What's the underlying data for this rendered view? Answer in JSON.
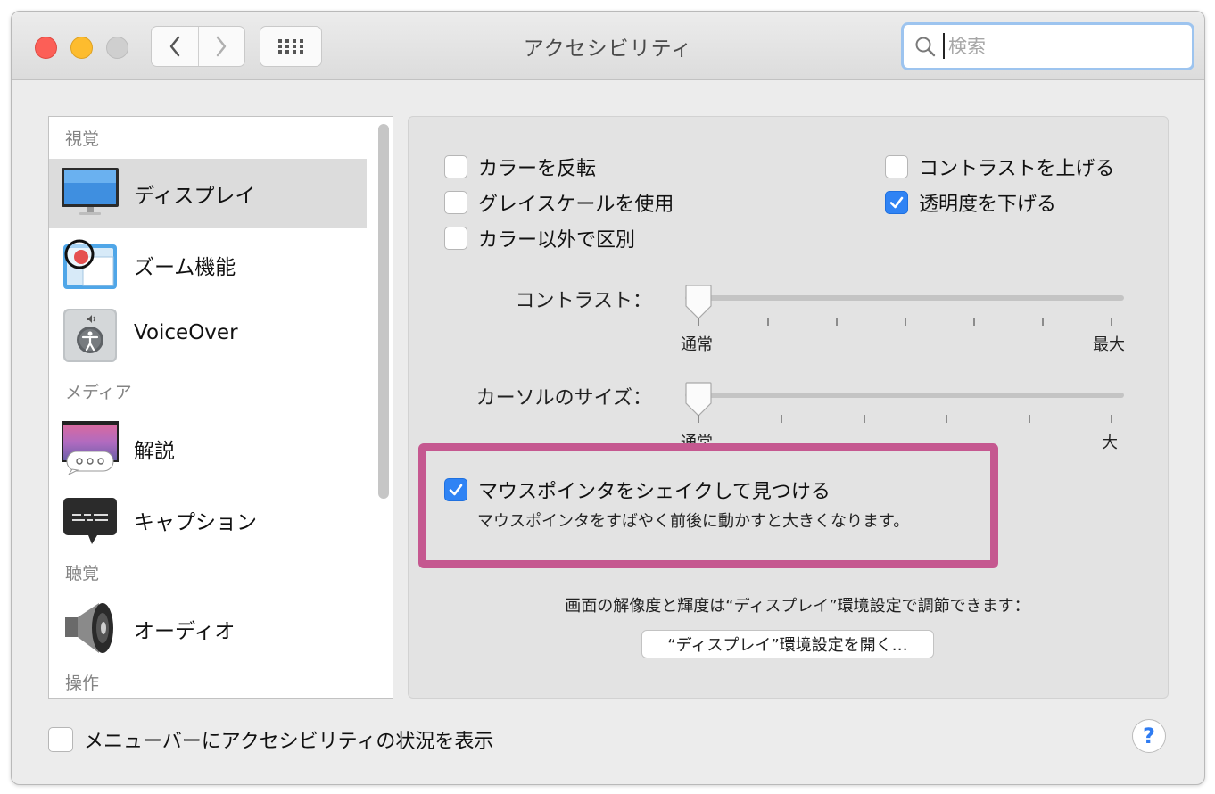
{
  "window": {
    "title": "アクセシビリティ"
  },
  "search": {
    "placeholder": "検索",
    "value": ""
  },
  "sidebar": {
    "sections": [
      {
        "label": "視覚"
      },
      {
        "label": "メディア"
      },
      {
        "label": "聴覚"
      },
      {
        "label": "操作"
      }
    ],
    "items": [
      {
        "label": "ディスプレイ",
        "icon": "display-icon",
        "selected": true
      },
      {
        "label": "ズーム機能",
        "icon": "zoom-icon"
      },
      {
        "label": "VoiceOver",
        "icon": "voiceover-icon"
      },
      {
        "label": "解説",
        "icon": "descriptions-icon"
      },
      {
        "label": "キャプション",
        "icon": "captions-icon"
      },
      {
        "label": "オーディオ",
        "icon": "speaker-icon"
      }
    ]
  },
  "display": {
    "checkboxes": [
      {
        "label": "カラーを反転",
        "checked": false
      },
      {
        "label": "グレイスケールを使用",
        "checked": false
      },
      {
        "label": "カラー以外で区別",
        "checked": false
      },
      {
        "label": "コントラストを上げる",
        "checked": false
      },
      {
        "label": "透明度を下げる",
        "checked": true
      }
    ],
    "contrast": {
      "label": "コントラスト：",
      "min_label": "通常",
      "max_label": "最大",
      "value": 0
    },
    "cursor_size": {
      "label": "カーソルのサイズ：",
      "min_label": "通常",
      "max_label": "大",
      "value": 0
    },
    "shake": {
      "label": "マウスポインタをシェイクして見つける",
      "description": "マウスポインタをすばやく前後に動かすと大きくなります。",
      "checked": true
    },
    "resolution_note": "画面の解像度と輝度は“ディスプレイ”環境設定で調節できます：",
    "open_button": "“ディスプレイ”環境設定を開く…"
  },
  "footer": {
    "menubar_checkbox": {
      "label": "メニューバーにアクセシビリティの状況を表示",
      "checked": false
    },
    "help": "?"
  },
  "colors": {
    "accent": "#2f83f4",
    "highlight": "#c55890",
    "close": "#fc5f57",
    "minimize": "#fdbc2e"
  }
}
